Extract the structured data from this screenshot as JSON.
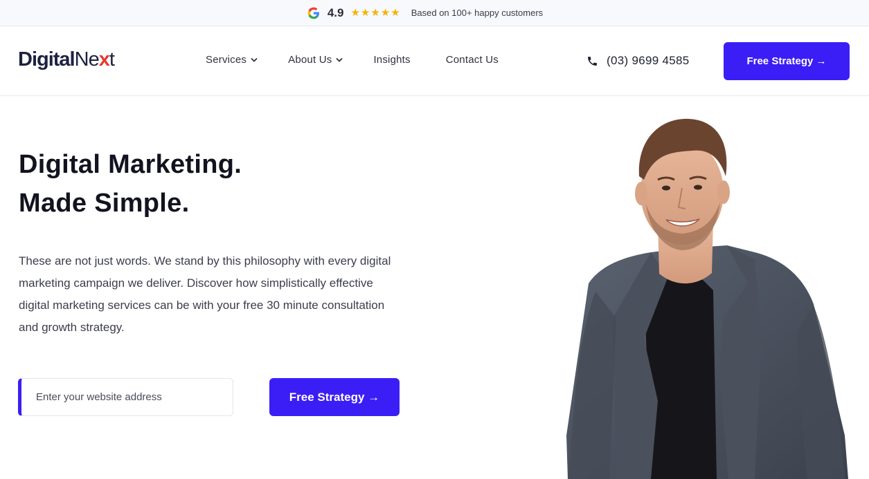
{
  "rating_bar": {
    "score": "4.9",
    "stars": [
      "★",
      "★",
      "★",
      "★",
      "★"
    ],
    "text": "Based on 100+ happy customers"
  },
  "header": {
    "logo": {
      "part1": "Digital",
      "part2": "Ne",
      "x1": "x",
      "x2": "",
      "part3": "t"
    },
    "nav": [
      {
        "label": "Services",
        "has_dropdown": true
      },
      {
        "label": "About Us",
        "has_dropdown": true
      },
      {
        "label": "Insights",
        "has_dropdown": false
      },
      {
        "label": "Contact Us",
        "has_dropdown": false
      }
    ],
    "phone": "(03) 9699 4585",
    "cta_label": "Free Strategy →"
  },
  "hero": {
    "title_line1": "Digital Marketing.",
    "title_line2": "Made Simple.",
    "body": "These are not just words. We stand by this philosophy with every digital marketing campaign we deliver. Discover how simplistically effective digital marketing services can be with your free 30 minute consultation and growth strategy.",
    "input_placeholder": "Enter your website address",
    "cta_label": "Free Strategy →"
  },
  "colors": {
    "accent": "#3b1ef5",
    "star": "#f5b301",
    "heading": "#12131f"
  },
  "icons": [
    "google-icon",
    "star-icon",
    "chevron-down-icon",
    "phone-icon",
    "arrow-right-icon"
  ]
}
